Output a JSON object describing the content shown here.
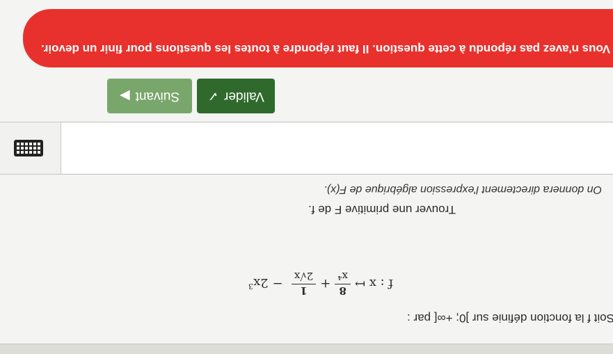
{
  "question": {
    "intro": "Soit f la fonction définie sur ]0; +∞[ par :",
    "formula": {
      "lhs": "f : x ↦",
      "term1_num": "8",
      "term1_den": "x⁴",
      "plus": "+",
      "term2_num": "1",
      "term2_den": "2√x",
      "minus": "−",
      "term3_base": "2x",
      "term3_exp": "3"
    },
    "task": "Trouver une primitive F de f.",
    "hint": "On donnera directement l'expression algébrique de F(x)."
  },
  "answer": {
    "value": ""
  },
  "keyboard_button": {
    "icon": "keyboard-icon"
  },
  "buttons": {
    "validate": "Valider",
    "validate_icon": "✓",
    "next": "Suivant",
    "next_icon": "▶"
  },
  "alert": {
    "message": "Vous n'avez pas répondu à cette question. Il faut répondre à toutes les questions pour finir un devoir.",
    "color": "#e8312d"
  },
  "colors": {
    "validate": "#2f6a2c",
    "next": "#79a66b"
  }
}
